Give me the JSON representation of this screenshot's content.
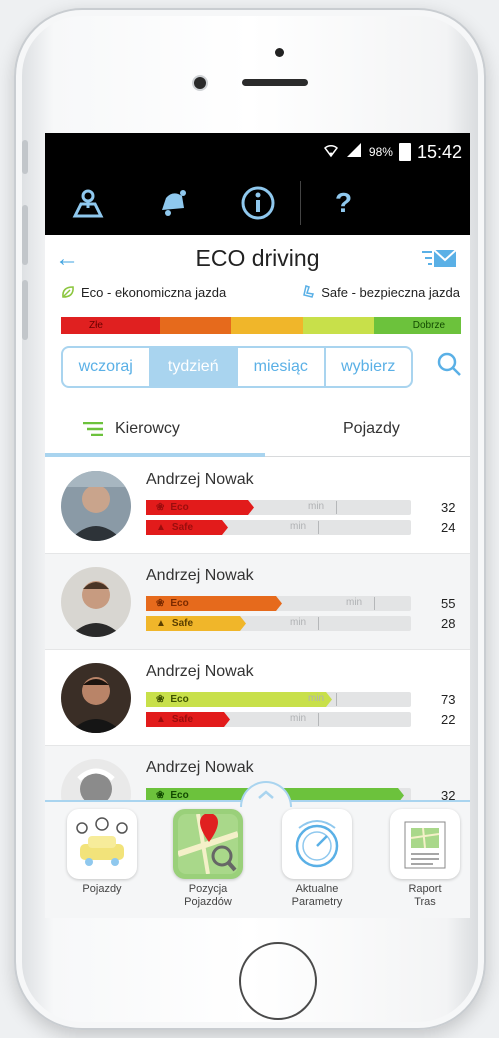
{
  "status": {
    "battery": "98%",
    "time": "15:42"
  },
  "nav": {
    "items": [
      "map-route-icon",
      "bell-icon",
      "info-icon",
      "help-icon"
    ],
    "help_label": "?"
  },
  "header": {
    "title": "ECO driving"
  },
  "legend": {
    "eco_label": "Eco - ekonomiczna jazda",
    "safe_label": "Safe - bezpieczna jazda"
  },
  "scale": {
    "bad_label": "Złe",
    "good_label": "Dobrze"
  },
  "period": {
    "options": [
      "wczoraj",
      "tydzień",
      "miesiąc",
      "wybierz"
    ],
    "selected": "tydzień"
  },
  "tabs": {
    "drivers": "Kierowcy",
    "vehicles": "Pojazdy",
    "selected": "Kierowcy"
  },
  "bar_labels": {
    "eco": "Eco",
    "safe": "Safe",
    "min": "min"
  },
  "drivers": [
    {
      "name": "Andrzej Nowak",
      "eco": 32,
      "safe": 24,
      "eco_color": "#e21b1b",
      "safe_color": "#e21b1b"
    },
    {
      "name": "Andrzej Nowak",
      "eco": 55,
      "safe": 28,
      "eco_color": "#e66a1c",
      "safe_color": "#f0b62a"
    },
    {
      "name": "Andrzej Nowak",
      "eco": 73,
      "safe": 22,
      "eco_color": "#c8e04a",
      "safe_color": "#e21b1b"
    },
    {
      "name": "Andrzej Nowak",
      "eco": 32,
      "eco_color": "#6cc23c"
    }
  ],
  "dock": {
    "items": [
      {
        "label": "Pojazdy"
      },
      {
        "label": "Pozycja\nPojazdów"
      },
      {
        "label": "Aktualne\nParametry"
      },
      {
        "label": "Raport\nTras"
      }
    ]
  },
  "colors": {
    "accent": "#5ab0e6",
    "accent_light": "#a9d4ef",
    "nav_bg": "#000000"
  }
}
